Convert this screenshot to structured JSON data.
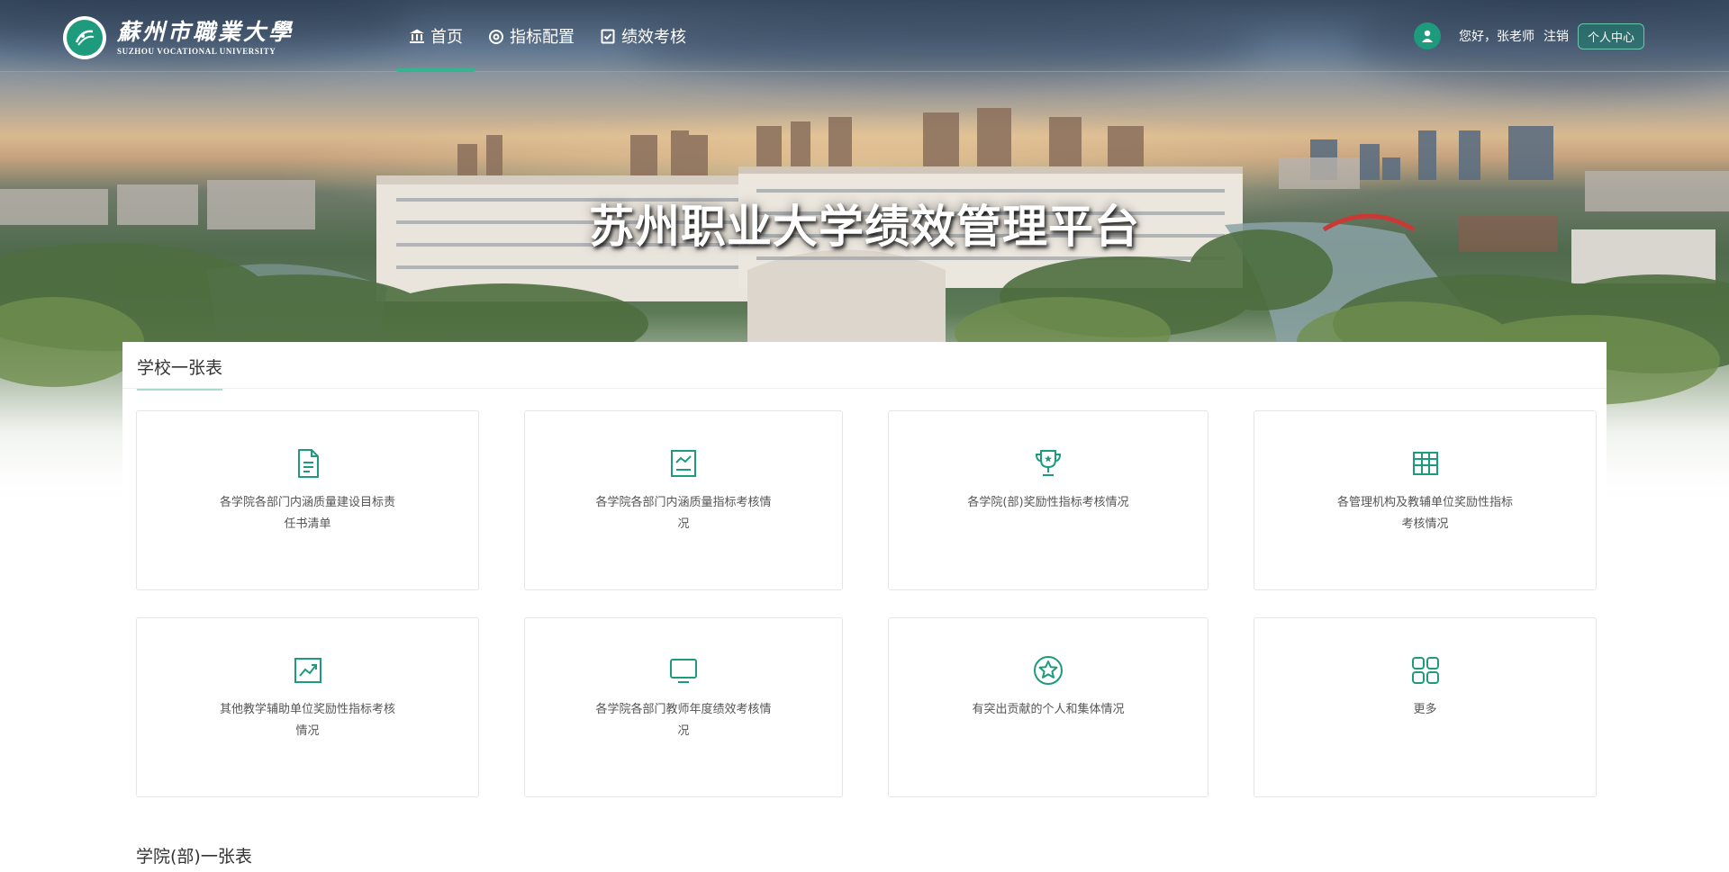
{
  "header": {
    "logo_cn": "蘇州市職業大學",
    "logo_en": "SUZHOU VOCATIONAL UNIVERSITY",
    "nav": [
      {
        "label": "首页",
        "icon": "bank-icon",
        "active": true
      },
      {
        "label": "指标配置",
        "icon": "gauge-icon",
        "active": false
      },
      {
        "label": "绩效考核",
        "icon": "checklist-icon",
        "active": false
      }
    ],
    "user": {
      "greeting": "您好，张老师",
      "logout": "注销",
      "profile_button": "个人中心"
    }
  },
  "hero": {
    "title": "苏州职业大学绩效管理平台"
  },
  "school_section": {
    "title": "学校一张表",
    "cards": [
      {
        "label": "各学院各部门内涵质量建设目标责任书清单",
        "icon": "document-icon"
      },
      {
        "label": "各学院各部门内涵质量指标考核情况",
        "icon": "chart-report-icon"
      },
      {
        "label": "各学院(部)奖励性指标考核情况",
        "icon": "trophy-icon"
      },
      {
        "label": "各管理机构及教辅单位奖励性指标考核情况",
        "icon": "table-icon"
      },
      {
        "label": "其他教学辅助单位奖励性指标考核情况",
        "icon": "trend-chart-icon"
      },
      {
        "label": "各学院各部门教师年度绩效考核情况",
        "icon": "monitor-icon"
      },
      {
        "label": "有突出贡献的个人和集体情况",
        "icon": "star-circle-icon"
      },
      {
        "label": "更多",
        "icon": "grid-more-icon"
      }
    ]
  },
  "college_section": {
    "title": "学院(部)一张表"
  },
  "colors": {
    "accent": "#1d9b7c",
    "nav_active": "#35b58f"
  }
}
